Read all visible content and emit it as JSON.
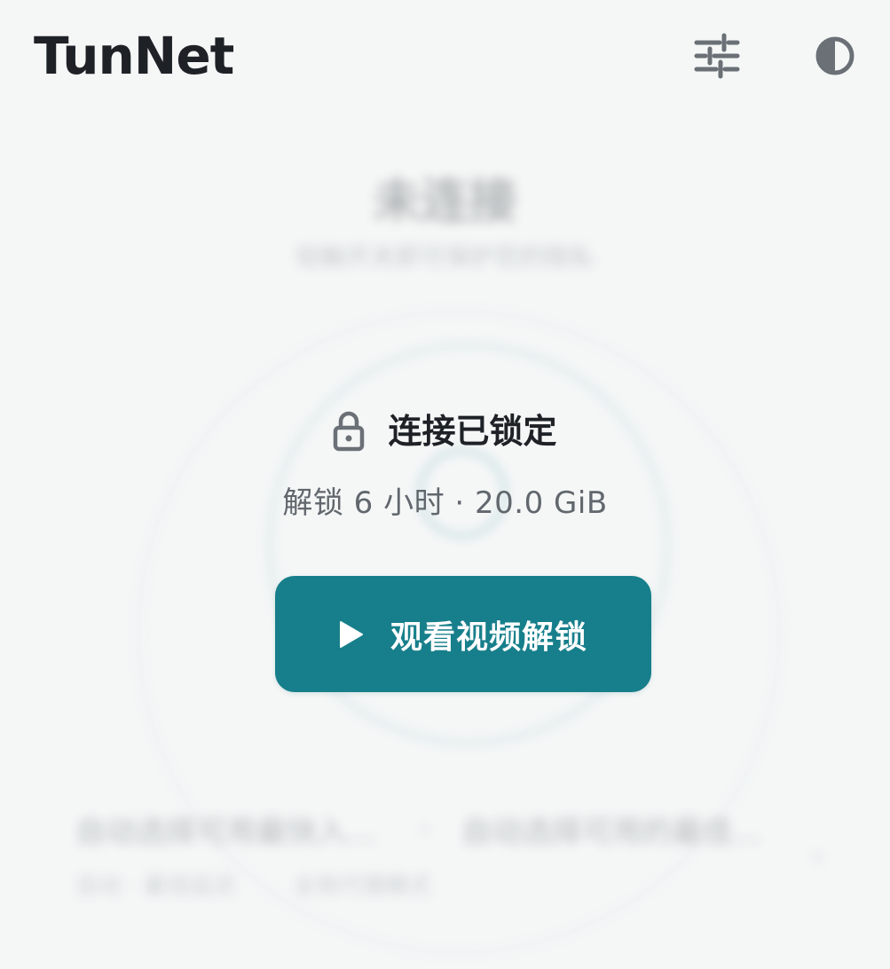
{
  "header": {
    "app_title": "TunNet",
    "settings_icon": "sliders-icon",
    "theme_icon": "contrast-icon"
  },
  "background": {
    "status_title": "未连接",
    "status_subtitle": "轻触开关即可保护您的隐私",
    "location_left": "自动选择可用最快入...",
    "separator": "›",
    "location_right": "自动选择可用的最佳...",
    "meta_latency": "自动 · 最佳延迟",
    "meta_mode": "全局代理模式",
    "chevron": "›"
  },
  "lock": {
    "icon": "lock-icon",
    "title": "连接已锁定",
    "subtitle": "解锁 6 小时 · 20.0 GiB"
  },
  "unlock_button": {
    "icon": "play-icon",
    "label": "观看视频解锁"
  },
  "colors": {
    "accent": "#177f8b",
    "background": "#f5f7f7",
    "title": "#1e2227",
    "icon_gray": "#6a7076"
  }
}
